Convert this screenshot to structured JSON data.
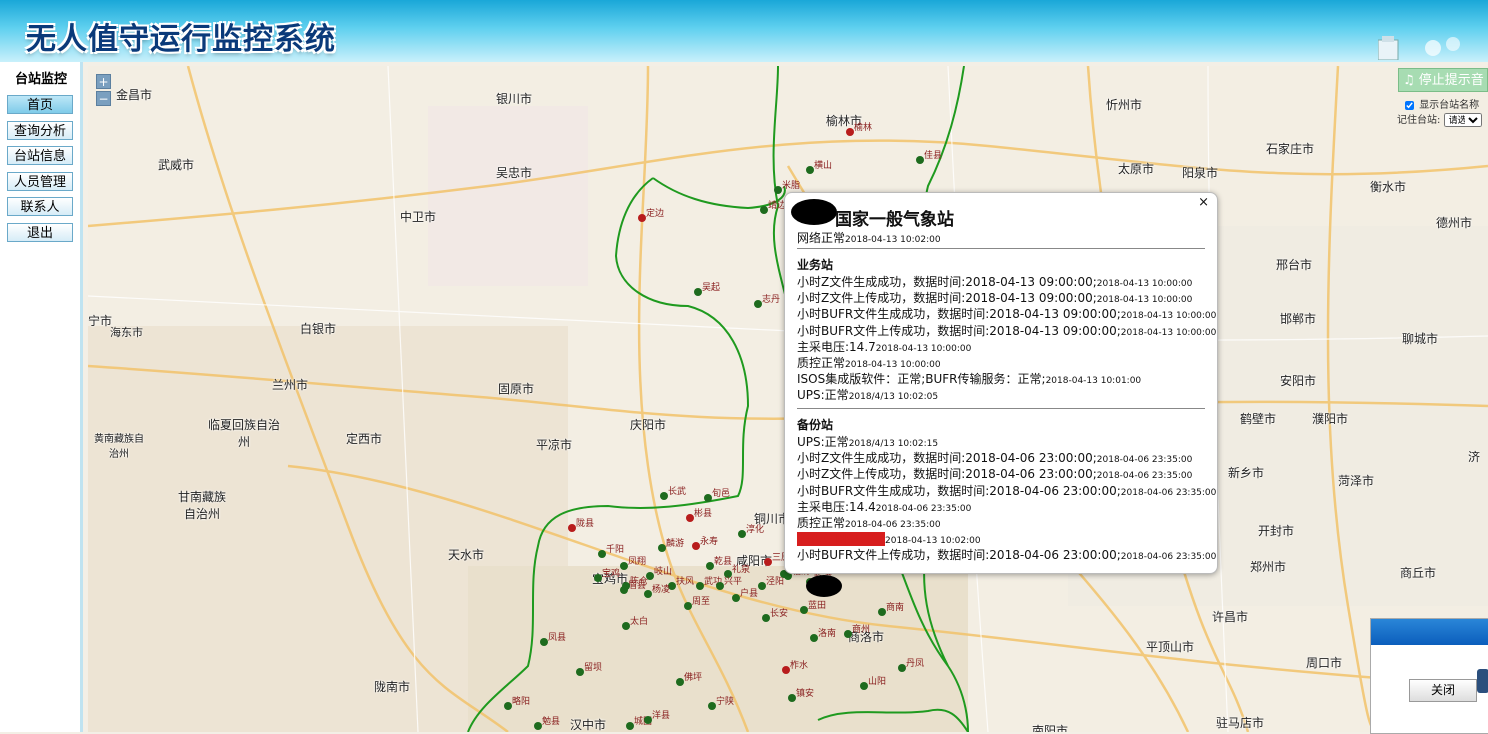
{
  "app": {
    "title": "无人值守运行监控系统"
  },
  "sidebar": {
    "heading": "台站监控",
    "items": [
      {
        "label": "首页"
      },
      {
        "label": "查询分析"
      },
      {
        "label": "台站信息"
      },
      {
        "label": "人员管理"
      },
      {
        "label": "联系人"
      },
      {
        "label": "退出"
      }
    ]
  },
  "map": {
    "zoom_in": "+",
    "zoom_out": "−",
    "cities": [
      "金昌市",
      "银川市",
      "榆林市",
      "忻州市",
      "石家庄市",
      "武威市",
      "吴忠市",
      "太原市",
      "阳泉市",
      "衡水市",
      "中卫市",
      "德州市",
      "宁市",
      "海东市",
      "白银市",
      "兰州市",
      "固原市",
      "邢台市",
      "邯郸市",
      "聊城市",
      "临夏回族自治州",
      "定西市",
      "平凉市",
      "庆阳市",
      "安阳市",
      "鹤壁市",
      "濮阳市",
      "黄南藏族自治州",
      "新乡市",
      "济",
      "菏泽市",
      "甘南藏族自治州",
      "天水市",
      "开封市",
      "郑州市",
      "商丘市",
      "许昌市",
      "平顶山市",
      "周口市",
      "陇南市",
      "汉中市",
      "宝鸡市",
      "商洛市",
      "铜川市",
      "咸阳市",
      "驻马店市",
      "南阳市"
    ],
    "station_labels": [
      "榆林",
      "横山",
      "佳县",
      "米脂",
      "靖边",
      "定边",
      "吴起",
      "志丹",
      "长武",
      "旬邑",
      "彬县",
      "陇县",
      "千阳",
      "凤翔",
      "麟游",
      "永寿",
      "乾县",
      "礼泉",
      "三原",
      "岐山",
      "扶风",
      "武功",
      "眉县",
      "杨凌",
      "兴平",
      "周至",
      "户县",
      "蓝田",
      "长安",
      "太白",
      "凤县",
      "留坝",
      "佛坪",
      "宁陕",
      "柞水",
      "镇安",
      "山阳",
      "丹凤",
      "商南",
      "洛南",
      "略阳",
      "勉县",
      "城固",
      "洋县",
      "淳化",
      "泾阳",
      "高陵",
      "临潼",
      "商州",
      "宝鸡",
      "陈仓",
      "临渭"
    ]
  },
  "controls": {
    "stop_sound": "停止提示音",
    "show_names": "显示台站名称",
    "remember_label": "记住台站:",
    "remember_value": "请选择"
  },
  "popup": {
    "title": "国家一般气象站",
    "close": "×",
    "network": {
      "text": "网络正常",
      "ts": "2018-04-13 10:02:00"
    },
    "primary": {
      "heading": "业务站",
      "lines": [
        {
          "text": "小时Z文件生成成功，数据时间:2018-04-13 09:00:00;",
          "ts": "2018-04-13 10:00:00"
        },
        {
          "text": "小时Z文件上传成功，数据时间:2018-04-13 09:00:00;",
          "ts": "2018-04-13 10:00:00"
        },
        {
          "text": "小时BUFR文件生成成功，数据时间:2018-04-13 09:00:00;",
          "ts": "2018-04-13 10:00:00"
        },
        {
          "text": "小时BUFR文件上传成功，数据时间:2018-04-13 09:00:00;",
          "ts": "2018-04-13 10:00:00"
        },
        {
          "text": "主采电压:14.7",
          "ts": "2018-04-13 10:00:00"
        },
        {
          "text": "质控正常",
          "ts": "2018-04-13 10:00:00"
        },
        {
          "text": "ISOS集成版软件：正常;BUFR传输服务：正常;",
          "ts": "2018-04-13 10:01:00"
        },
        {
          "text": "UPS:正常",
          "ts": "2018/4/13 10:02:05"
        }
      ]
    },
    "backup": {
      "heading": "备份站",
      "lines": [
        {
          "text": "UPS:正常",
          "ts": "2018/4/13 10:02:15"
        },
        {
          "text": "小时Z文件生成成功，数据时间:2018-04-06 23:00:00;",
          "ts": "2018-04-06 23:35:00"
        },
        {
          "text": "小时Z文件上传成功，数据时间:2018-04-06 23:00:00;",
          "ts": "2018-04-06 23:35:00"
        },
        {
          "text": "小时BUFR文件生成成功，数据时间:2018-04-06 23:00:00;",
          "ts": "2018-04-06 23:35:00"
        },
        {
          "text": "主采电压:14.4",
          "ts": "2018-04-06 23:35:00"
        },
        {
          "text": "质控正常",
          "ts": "2018-04-06 23:35:00"
        },
        {
          "text": "备份站网络异常",
          "ts": "2018-04-13 10:02:00",
          "alert": true
        },
        {
          "text": "小时BUFR文件上传成功，数据时间:2018-04-06 23:00:00;",
          "ts": "2018-04-06 23:35:00"
        }
      ]
    }
  },
  "dialog": {
    "close": "关闭"
  },
  "colors": {
    "boundary": "#1f9a1f",
    "station_ok": "#1e6b1e",
    "station_alert": "#b81c1c",
    "alert_bg": "#d71e1e",
    "banner": "#1aa7d8"
  }
}
